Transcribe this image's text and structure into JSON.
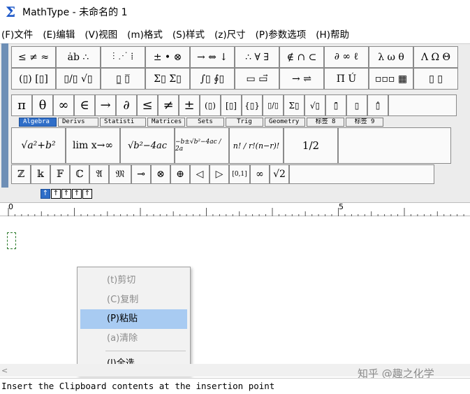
{
  "window": {
    "title": "MathType - 未命名的 1",
    "app_icon": "sigma-icon"
  },
  "menu": [
    "(F)文件",
    "(E)编辑",
    "(V)视图",
    "(m)格式",
    "(S)样式",
    "(z)尺寸",
    "(P)参数选项",
    "(H)帮助"
  ],
  "symbol_palette_row1": [
    "≤ ≠ ≈",
    "ȧb ∴",
    "⫶ ⋰ ⁞",
    "± • ⊗",
    "→ ⇔ ↓",
    "∴ ∀ ∃",
    "∉ ∩ ⊂",
    "∂ ∞ ℓ",
    "λ ω θ",
    "Λ Ω Θ"
  ],
  "symbol_palette_row2": [
    "(▯) [▯]",
    "▯/▯ √▯",
    "▯̲ ▯̅",
    "Σ▯ Σ▯",
    "∫▯ ∮▯",
    "▭ ▭⃗",
    "→ ⇌",
    "Π̄ Ú",
    "▫▫▫ ▦",
    "▯ ▯"
  ],
  "small_symbols": [
    "π",
    "θ",
    "∞",
    "∈",
    "→",
    "∂",
    "≤",
    "≠",
    "±",
    "(▯)",
    "[▯]",
    "{▯}",
    "▯/▯",
    "Σ▯",
    "√▯",
    "▯̄",
    "▯",
    "▯̂"
  ],
  "tabs": [
    "Algebra",
    "Derivs",
    "Statisti",
    "Matrices",
    "Sets",
    "Trig",
    "Geometry",
    "标签 8",
    "标签 9"
  ],
  "active_tab": "Algebra",
  "templates": [
    "√a²+b²",
    "lim x→∞",
    "√b²−4ac",
    "−b±√b²−4ac / 2a",
    "n! / r!(n−r)!",
    "1/2"
  ],
  "bottom_symbols": [
    "ℤ",
    "𝕜",
    "𝔽",
    "ℂ",
    "𝔄",
    "𝔐",
    "⊸",
    "⊗",
    "⊕",
    "◁",
    "▷",
    "[0,1]",
    "∞",
    "√2"
  ],
  "size_buttons": [
    "↑",
    "↑",
    "↑",
    "↑",
    "↑"
  ],
  "ruler": {
    "labels": [
      "0",
      "5"
    ]
  },
  "context_menu": {
    "items": [
      {
        "label": "(t)剪切",
        "enabled": false
      },
      {
        "label": "(C)复制",
        "enabled": false
      },
      {
        "label": "(P)粘贴",
        "enabled": true,
        "highlighted": true
      },
      {
        "label": "(a)清除",
        "enabled": false
      },
      {
        "label": "(l)全选",
        "enabled": true
      }
    ]
  },
  "status_text": "Insert the Clipboard contents at the insertion point",
  "watermark": "知乎 @趣之化学"
}
